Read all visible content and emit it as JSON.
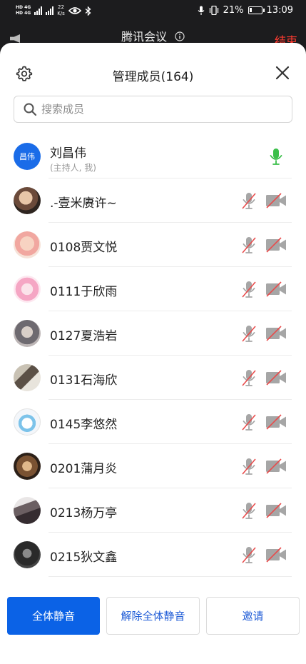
{
  "status_bar": {
    "sim1": "HD 4G",
    "sim2": "HD 4G",
    "net_speed_value": "22",
    "net_speed_unit": "K/s",
    "battery": "21%",
    "battery_level": 0.21,
    "time": "13:09"
  },
  "behind": {
    "title": "腾讯会议",
    "end_label": "结束"
  },
  "sheet": {
    "title": "管理成员(164)"
  },
  "search": {
    "placeholder": "搜索成员"
  },
  "host": {
    "avatar_text": "昌伟",
    "name": "刘昌伟",
    "role": "(主持人, 我)"
  },
  "members": [
    {
      "name": ".-壹米赓许~"
    },
    {
      "name": "0108贾文悦"
    },
    {
      "name": "0111于欣雨"
    },
    {
      "name": "0127夏浩岩"
    },
    {
      "name": "0131石海欣"
    },
    {
      "name": "0145李悠然"
    },
    {
      "name": "0201蒲月炎"
    },
    {
      "name": "0213杨万亭"
    },
    {
      "name": "0215狄文鑫"
    }
  ],
  "buttons": {
    "mute_all": "全体静音",
    "unmute_all": "解除全体静音",
    "invite": "邀请"
  },
  "colors": {
    "primary": "#0b62e6",
    "mic_on": "#3bbf4a",
    "muted_slash": "#e84b4b"
  }
}
